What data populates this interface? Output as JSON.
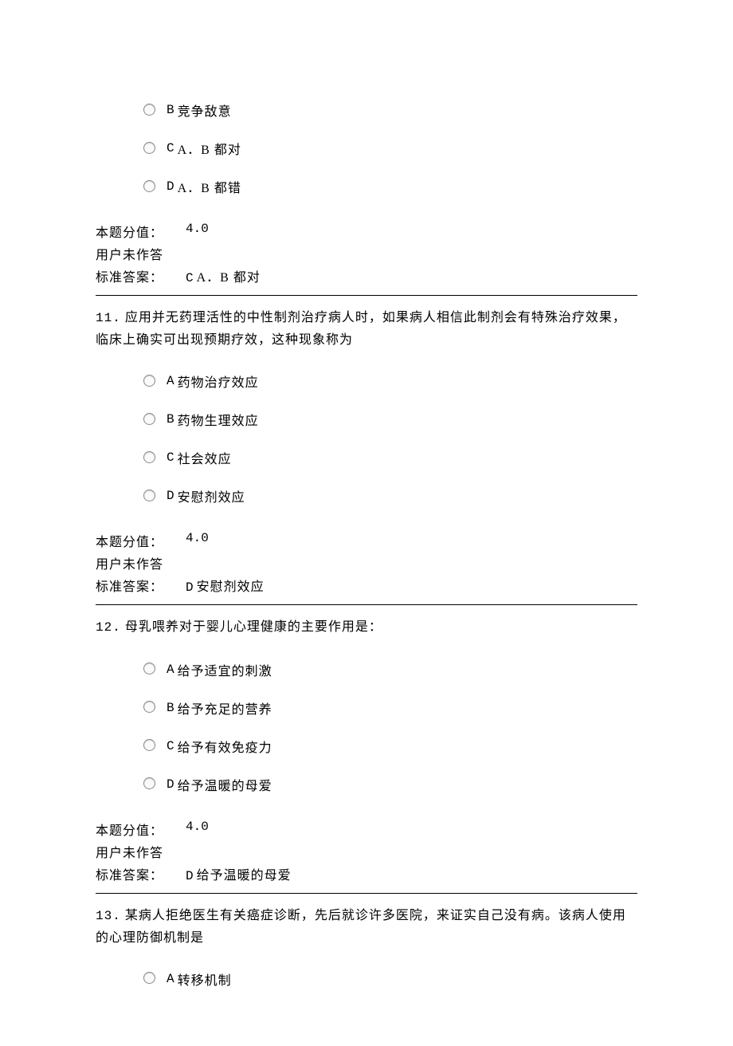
{
  "labels": {
    "score_label": "本题分值：",
    "unanswered": "用户未作答",
    "answer_label": "标准答案："
  },
  "q10_tail": {
    "options": [
      {
        "letter": "B",
        "text": "竞争敌意"
      },
      {
        "letter": "C",
        "text": "A．B 都对"
      },
      {
        "letter": "D",
        "text": "A．B 都错"
      }
    ],
    "score": "4.0",
    "answer_letter": "C",
    "answer_text": "A．B 都对"
  },
  "q11": {
    "number": "11.",
    "text": "应用并无药理活性的中性制剂治疗病人时，如果病人相信此制剂会有特殊治疗效果，临床上确实可出现预期疗效，这种现象称为",
    "options": [
      {
        "letter": "A",
        "text": "药物治疗效应"
      },
      {
        "letter": "B",
        "text": "药物生理效应"
      },
      {
        "letter": "C",
        "text": "社会效应"
      },
      {
        "letter": "D",
        "text": "安慰剂效应"
      }
    ],
    "score": "4.0",
    "answer_letter": "D",
    "answer_text": "安慰剂效应"
  },
  "q12": {
    "number": "12.",
    "text": "母乳喂养对于婴儿心理健康的主要作用是：",
    "options": [
      {
        "letter": "A",
        "text": "给予适宜的刺激"
      },
      {
        "letter": "B",
        "text": "给予充足的营养"
      },
      {
        "letter": "C",
        "text": "给予有效免疫力"
      },
      {
        "letter": "D",
        "text": "给予温暖的母爱"
      }
    ],
    "score": "4.0",
    "answer_letter": "D",
    "answer_text": "给予温暖的母爱"
  },
  "q13": {
    "number": "13.",
    "text": "某病人拒绝医生有关癌症诊断，先后就诊许多医院，来证实自己没有病。该病人使用的心理防御机制是",
    "options": [
      {
        "letter": "A",
        "text": "转移机制"
      }
    ]
  }
}
